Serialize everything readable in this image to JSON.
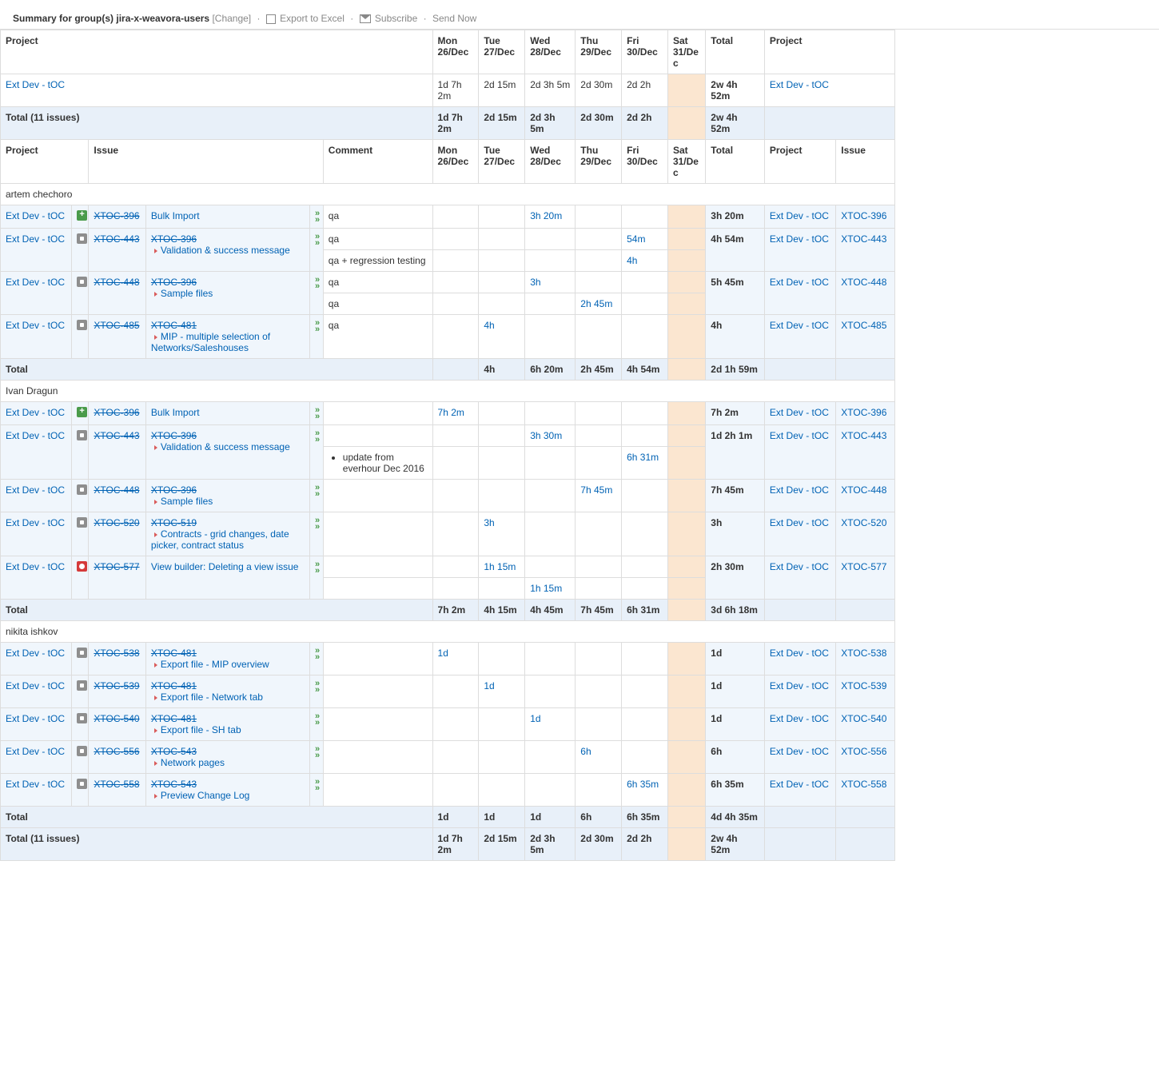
{
  "header": {
    "prefix": "Summary for group(s) ",
    "group": "jira-x-weavora-users",
    "change": "[Change]",
    "export": "Export to Excel",
    "subscribe": "Subscribe",
    "send_now": "Send Now"
  },
  "days": [
    {
      "top": "Mon",
      "bot": "26/Dec"
    },
    {
      "top": "Tue",
      "bot": "27/Dec"
    },
    {
      "top": "Wed",
      "bot": "28/Dec"
    },
    {
      "top": "Thu",
      "bot": "29/Dec"
    },
    {
      "top": "Fri",
      "bot": "30/Dec"
    },
    {
      "top": "Sat",
      "bot": "31/Dec"
    }
  ],
  "hdr": {
    "project": "Project",
    "issue": "Issue",
    "comment": "Comment",
    "total": "Total"
  },
  "summary": {
    "row1": {
      "project": "Ext Dev - tOC",
      "vals": [
        "1d 7h 2m",
        "2d 15m",
        "2d 3h 5m",
        "2d 30m",
        "2d 2h",
        ""
      ],
      "total": "2w 4h 52m"
    },
    "row_total_label": "Total (11 issues)",
    "row2": {
      "vals": [
        "1d 7h 2m",
        "2d 15m",
        "2d 3h 5m",
        "2d 30m",
        "2d 2h",
        ""
      ],
      "total": "2w 4h 52m"
    }
  },
  "users": [
    {
      "name": "artem chechoro",
      "rows": [
        {
          "icon": "green",
          "key": "XTOC-396",
          "parent": "",
          "title": "Bulk Import",
          "comments": [
            "qa"
          ],
          "vals": [
            [
              "",
              "",
              "3h 20m",
              "",
              "",
              ""
            ]
          ],
          "total": "3h 20m",
          "issue": "XTOC-396"
        },
        {
          "icon": "grey",
          "key": "XTOC-443",
          "parent": "XTOC-396",
          "title": "Validation & success message",
          "comments": [
            "qa",
            "qa + regression testing"
          ],
          "vals": [
            [
              "",
              "",
              "",
              "",
              "54m",
              ""
            ],
            [
              "",
              "",
              "",
              "",
              "4h",
              ""
            ]
          ],
          "total": "4h 54m",
          "issue": "XTOC-443"
        },
        {
          "icon": "grey",
          "key": "XTOC-448",
          "parent": "XTOC-396",
          "title": "Sample files",
          "comments": [
            "qa",
            "qa"
          ],
          "vals": [
            [
              "",
              "",
              "3h",
              "",
              "",
              ""
            ],
            [
              "",
              "",
              "",
              "2h 45m",
              "",
              ""
            ]
          ],
          "total": "5h 45m",
          "issue": "XTOC-448"
        },
        {
          "icon": "grey",
          "key": "XTOC-485",
          "parent": "XTOC-481",
          "title": "MIP - multiple selection of Networks/Saleshouses",
          "comments": [
            "qa"
          ],
          "vals": [
            [
              "",
              "4h",
              "",
              "",
              "",
              ""
            ]
          ],
          "total": "4h",
          "issue": "XTOC-485"
        }
      ],
      "total": {
        "label": "Total",
        "vals": [
          "",
          "4h",
          "6h 20m",
          "2h 45m",
          "4h 54m",
          ""
        ],
        "sum": "2d 1h 59m"
      }
    },
    {
      "name": "Ivan Dragun",
      "rows": [
        {
          "icon": "green",
          "key": "XTOC-396",
          "parent": "",
          "title": "Bulk Import",
          "comments": [
            ""
          ],
          "vals": [
            [
              "7h 2m",
              "",
              "",
              "",
              "",
              ""
            ]
          ],
          "total": "7h 2m",
          "issue": "XTOC-396"
        },
        {
          "icon": "grey",
          "key": "XTOC-443",
          "parent": "XTOC-396",
          "title": "Validation & success message",
          "comments": [
            "",
            "<ul class='cmt'><li>update from everhour Dec 2016</li></ul>"
          ],
          "vals": [
            [
              "",
              "",
              "3h 30m",
              "",
              "",
              ""
            ],
            [
              "",
              "",
              "",
              "",
              "6h 31m",
              ""
            ]
          ],
          "total": "1d 2h 1m",
          "issue": "XTOC-443"
        },
        {
          "icon": "grey",
          "key": "XTOC-448",
          "parent": "XTOC-396",
          "title": "Sample files",
          "comments": [
            ""
          ],
          "vals": [
            [
              "",
              "",
              "",
              "7h 45m",
              "",
              ""
            ]
          ],
          "total": "7h 45m",
          "issue": "XTOC-448"
        },
        {
          "icon": "grey",
          "key": "XTOC-520",
          "parent": "XTOC-519",
          "title": "Contracts - grid changes, date picker, contract status",
          "comments": [
            ""
          ],
          "vals": [
            [
              "",
              "3h",
              "",
              "",
              "",
              ""
            ]
          ],
          "total": "3h",
          "issue": "XTOC-520"
        },
        {
          "icon": "red",
          "key": "XTOC-577",
          "parent": "",
          "title": "View builder: Deleting a view issue",
          "comments": [
            "",
            ""
          ],
          "vals": [
            [
              "",
              "1h 15m",
              "",
              "",
              "",
              ""
            ],
            [
              "",
              "",
              "1h 15m",
              "",
              "",
              ""
            ]
          ],
          "total": "2h 30m",
          "issue": "XTOC-577"
        }
      ],
      "total": {
        "label": "Total",
        "vals": [
          "7h 2m",
          "4h 15m",
          "4h 45m",
          "7h 45m",
          "6h 31m",
          ""
        ],
        "sum": "3d 6h 18m"
      }
    },
    {
      "name": "nikita ishkov",
      "rows": [
        {
          "icon": "grey",
          "key": "XTOC-538",
          "parent": "XTOC-481",
          "title": "Export file - MIP overview",
          "comments": [
            ""
          ],
          "vals": [
            [
              "1d",
              "",
              "",
              "",
              "",
              ""
            ]
          ],
          "total": "1d",
          "issue": "XTOC-538"
        },
        {
          "icon": "grey",
          "key": "XTOC-539",
          "parent": "XTOC-481",
          "title": "Export file - Network tab",
          "comments": [
            ""
          ],
          "vals": [
            [
              "",
              "1d",
              "",
              "",
              "",
              ""
            ]
          ],
          "total": "1d",
          "issue": "XTOC-539"
        },
        {
          "icon": "grey",
          "key": "XTOC-540",
          "parent": "XTOC-481",
          "title": "Export file - SH tab",
          "comments": [
            ""
          ],
          "vals": [
            [
              "",
              "",
              "1d",
              "",
              "",
              ""
            ]
          ],
          "total": "1d",
          "issue": "XTOC-540"
        },
        {
          "icon": "grey",
          "key": "XTOC-556",
          "parent": "XTOC-543",
          "title": "Network pages",
          "comments": [
            ""
          ],
          "vals": [
            [
              "",
              "",
              "",
              "6h",
              "",
              ""
            ]
          ],
          "total": "6h",
          "issue": "XTOC-556"
        },
        {
          "icon": "grey",
          "key": "XTOC-558",
          "parent": "XTOC-543",
          "title": "Preview Change Log",
          "comments": [
            ""
          ],
          "vals": [
            [
              "",
              "",
              "",
              "",
              "6h 35m",
              ""
            ]
          ],
          "total": "6h 35m",
          "issue": "XTOC-558"
        }
      ],
      "total": {
        "label": "Total",
        "vals": [
          "1d",
          "1d",
          "1d",
          "6h",
          "6h 35m",
          ""
        ],
        "sum": "4d 4h 35m"
      }
    }
  ],
  "grand": {
    "label": "Total (11 issues)",
    "vals": [
      "1d 7h 2m",
      "2d 15m",
      "2d 3h 5m",
      "2d 30m",
      "2d 2h",
      ""
    ],
    "total": "2w 4h 52m"
  },
  "proj": "Ext Dev - tOC"
}
